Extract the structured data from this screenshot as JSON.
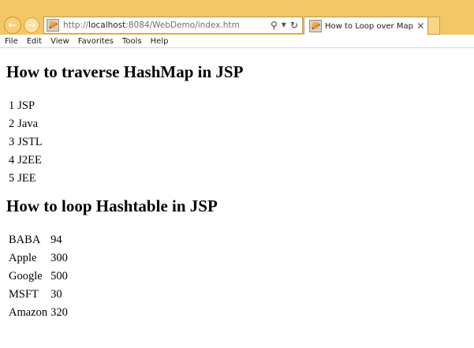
{
  "browser": {
    "url_prefix": "http://",
    "url_host": "localhost",
    "url_rest": ":8084/WebDemo/index.htm",
    "tab_title": "How to Loop over Map i.e. ...",
    "icons": {
      "back": "back-arrow-icon",
      "forward": "forward-arrow-icon",
      "search": "search-icon",
      "dropdown": "dropdown-icon",
      "refresh": "refresh-icon",
      "close": "close-icon",
      "favicon": "favicon-icon"
    }
  },
  "menu": {
    "items": [
      "File",
      "Edit",
      "View",
      "Favorites",
      "Tools",
      "Help"
    ]
  },
  "page": {
    "heading_map": "How to traverse HashMap in JSP",
    "map_rows": [
      {
        "key": "1",
        "value": "JSP"
      },
      {
        "key": "2",
        "value": "Java"
      },
      {
        "key": "3",
        "value": "JSTL"
      },
      {
        "key": "4",
        "value": "J2EE"
      },
      {
        "key": "5",
        "value": "JEE"
      }
    ],
    "heading_table": "How to loop Hashtable in JSP",
    "table_rows": [
      {
        "key": "BABA",
        "value": "94"
      },
      {
        "key": "Apple",
        "value": "300"
      },
      {
        "key": "Google",
        "value": "500"
      },
      {
        "key": "MSFT",
        "value": "30"
      },
      {
        "key": "Amazon",
        "value": "320"
      }
    ]
  }
}
